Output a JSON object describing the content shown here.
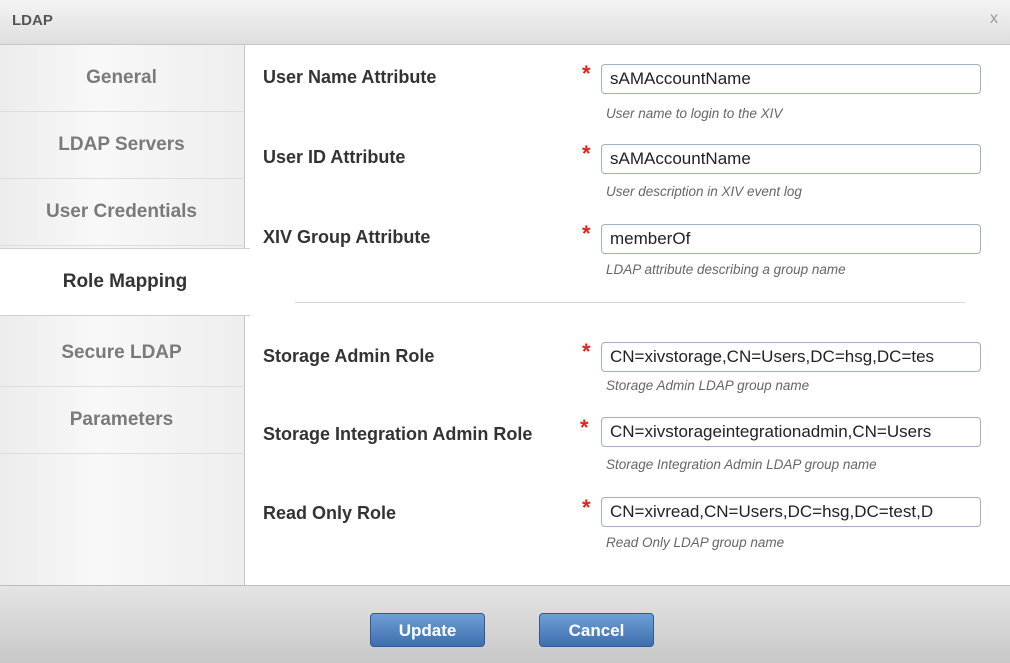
{
  "window": {
    "title": "LDAP",
    "close_label": "x"
  },
  "sidebar": {
    "tabs": [
      {
        "label": "General"
      },
      {
        "label": "LDAP Servers"
      },
      {
        "label": "User Credentials"
      },
      {
        "label": "Role Mapping",
        "active": true
      },
      {
        "label": "Secure LDAP"
      },
      {
        "label": "Parameters"
      }
    ]
  },
  "form": {
    "required_marker": "*",
    "fields": [
      {
        "label": "User Name Attribute",
        "value": "sAMAccountName",
        "hint": "User name to login to the XIV"
      },
      {
        "label": "User ID Attribute",
        "value": "sAMAccountName",
        "hint": "User description in XIV event log"
      },
      {
        "label": "XIV Group Attribute",
        "value": "memberOf",
        "hint": "LDAP attribute describing a group name"
      },
      {
        "label": "Storage Admin Role",
        "value": "CN=xivstorage,CN=Users,DC=hsg,DC=tes",
        "hint": "Storage Admin LDAP group name"
      },
      {
        "label": "Storage Integration Admin Role",
        "value": "CN=xivstorageintegrationadmin,CN=Users",
        "hint": "Storage Integration Admin LDAP group name"
      },
      {
        "label": "Read Only Role",
        "value": "CN=xivread,CN=Users,DC=hsg,DC=test,D",
        "hint": "Read Only LDAP group name"
      }
    ]
  },
  "footer": {
    "update_label": "Update",
    "cancel_label": "Cancel"
  },
  "colors": {
    "accent": "#4a7dbd",
    "required": "#e2231a"
  }
}
